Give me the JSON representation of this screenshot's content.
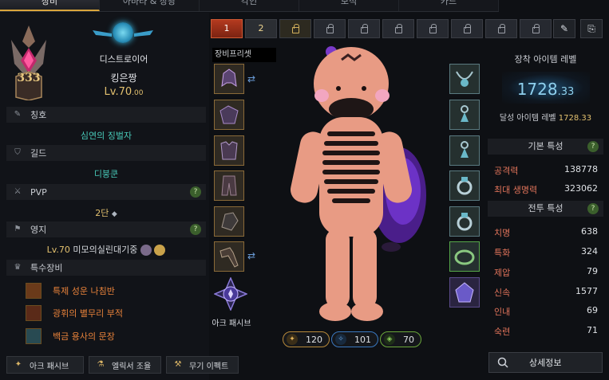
{
  "top_tabs": [
    "장비",
    "아바타 & 장광",
    "각인",
    "보석",
    "카드"
  ],
  "character": {
    "rank": "333",
    "class_name": "디스트로이어",
    "name": "킹은짱",
    "level_main": "Lv.70",
    "level_decimal": ".00"
  },
  "sections": {
    "title_label": "칭호",
    "title_value": "심연의 징벌자",
    "guild_label": "길드",
    "guild_value": "디붕쿤",
    "pvp_label": "PVP",
    "pvp_value": "2단",
    "estate_label": "영지",
    "estate_level": "Lv.70",
    "estate_value": "미모의실린대기중",
    "special_label": "특수장비",
    "help": "?"
  },
  "special_items": [
    "특제 성운 나침반",
    "광휘의 별무리 부적",
    "백금 용사의 문장"
  ],
  "bottom_buttons": [
    "아크 패시브",
    "엘릭서 조율",
    "무기 이펙트"
  ],
  "presets": {
    "tabs": [
      "1",
      "2"
    ],
    "label": "장비프리셋"
  },
  "ark_passive_label": "아크 패시브",
  "pills": [
    {
      "value": "120",
      "color": "#c99b45"
    },
    {
      "value": "101",
      "color": "#4f8fd8"
    },
    {
      "value": "70",
      "color": "#7bbf4a"
    }
  ],
  "right": {
    "item_level_title": "장착 아이템 레벨",
    "item_level_main": "1728",
    "item_level_decimal": ".33",
    "reach_label": "달성 아이템 레벨",
    "reach_value": "1728.33",
    "basic_title": "기본 특성",
    "basic_stats": [
      {
        "k": "공격력",
        "v": "138778"
      },
      {
        "k": "최대 생명력",
        "v": "323062"
      }
    ],
    "combat_title": "전투 특성",
    "combat_stats": [
      {
        "k": "치명",
        "v": "638"
      },
      {
        "k": "특화",
        "v": "324"
      },
      {
        "k": "제압",
        "v": "79"
      },
      {
        "k": "신속",
        "v": "1577"
      },
      {
        "k": "인내",
        "v": "69"
      },
      {
        "k": "숙련",
        "v": "71"
      }
    ],
    "detail_button": "상세정보"
  }
}
